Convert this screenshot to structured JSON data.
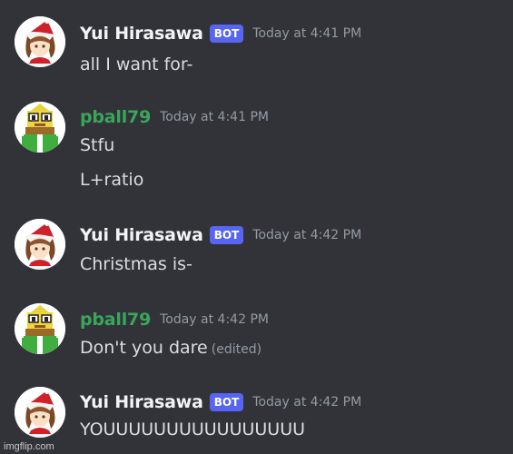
{
  "colors": {
    "background": "#313338",
    "bot_tag": "#5865f2",
    "pball_name": "#3ba55c",
    "yui_name": "#f2f3f5",
    "message_text": "#dbdee1",
    "timestamp": "#949ba4"
  },
  "messages": [
    {
      "author": "Yui Hirasawa",
      "bot_label": "BOT",
      "timestamp": "Today at 4:41 PM",
      "lines": [
        "all I want for-"
      ]
    },
    {
      "author": "pball79",
      "timestamp": "Today at 4:41 PM",
      "lines": [
        "Stfu",
        "L+ratio"
      ]
    },
    {
      "author": "Yui Hirasawa",
      "bot_label": "BOT",
      "timestamp": "Today at 4:42 PM",
      "lines": [
        "Christmas is-"
      ]
    },
    {
      "author": "pball79",
      "timestamp": "Today at 4:42 PM",
      "lines": [
        "Don't you dare"
      ],
      "edited_label": "(edited)"
    },
    {
      "author": "Yui Hirasawa",
      "bot_label": "BOT",
      "timestamp": "Today at 4:42 PM",
      "lines": [
        "YOUUUUUUUUUUUUUUUU"
      ]
    }
  ],
  "watermark": "imgflip.com"
}
